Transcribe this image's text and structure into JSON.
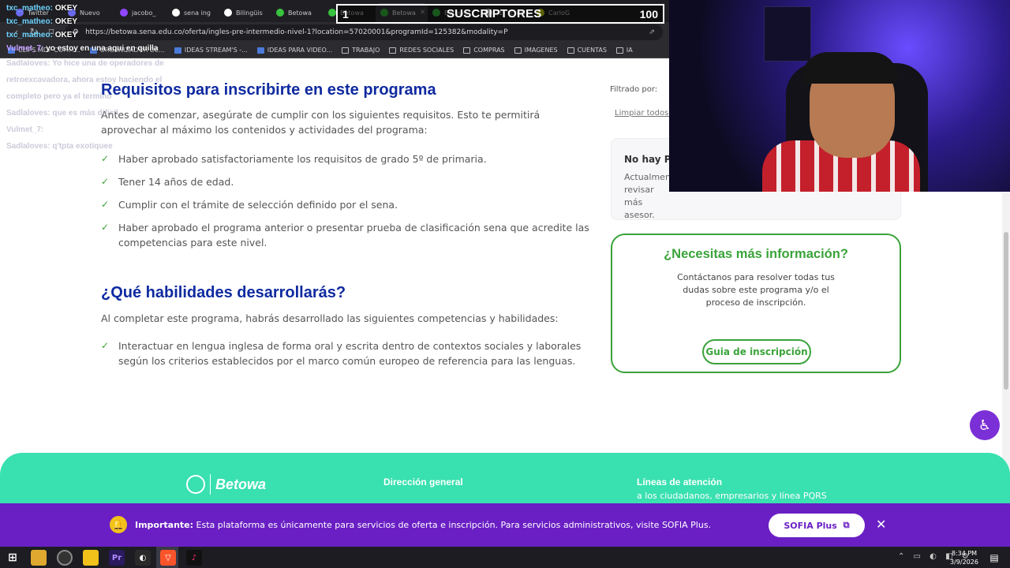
{
  "browser": {
    "tabs": [
      {
        "label": "Twitter",
        "color": "#6a6aee"
      },
      {
        "label": "Nuevo",
        "color": "#6a6aee"
      },
      {
        "label": "jacobo_",
        "color": "#9146ff"
      },
      {
        "label": "sena ing",
        "color": "#ffffff"
      },
      {
        "label": "Bilingüis",
        "color": "#ffffff"
      },
      {
        "label": "Betowa",
        "color": "#39c23f"
      },
      {
        "label": "Betowa",
        "color": "#39c23f"
      },
      {
        "label": "Betowa",
        "color": "#39c23f"
      },
      {
        "label": "Betowa",
        "color": "#39c23f"
      },
      {
        "label": "(1) \"cristi",
        "color": "#dddddd"
      },
      {
        "label": "CarloG",
        "color": "#c8d400"
      }
    ],
    "url": "https://betowa.sena.edu.co/oferta/ingles-pre-intermedio-nivel-1?location=57020001&programId=125382&modality=P",
    "bookmarks": [
      "CLIPS MDP COMM...",
      "ORGANIZADOR DE...",
      "IDEAS STREAM'S -...",
      "IDEAS PARA VIDEO...",
      "TRABAJO",
      "REDES SOCIALES",
      "COMPRAS",
      "IMAGENES",
      "CUENTAS",
      "IA"
    ]
  },
  "stream": {
    "sub_count": "1",
    "sub_label": "SUSCRIPTORES",
    "sub_goal": "100",
    "chat": [
      {
        "user": "txc_matheo:",
        "text": "OKEY"
      },
      {
        "user": "txc_matheo:",
        "text": "OKEY"
      },
      {
        "user": "txc_matheo:",
        "text": "OKEY"
      },
      {
        "user": "Vulmet_7:",
        "text": "yo estoy en una aqui en quilla"
      }
    ],
    "faded_chat": [
      "Sadlaloves: Yo hice una de operadores de retroexcavadora, ahora estoy haciendo el completo pero ya el termino",
      "Sadlaloves: que es más difícil",
      "Vulmet_7:",
      "Sadlaloves: q'tpta exotiquee"
    ]
  },
  "requirements": {
    "title": "Requisitos para inscribirte en este programa",
    "intro": "Antes de comenzar, asegúrate de cumplir con los siguientes requisitos. Esto te permitirá aprovechar al máximo los contenidos y actividades del programa:",
    "items": [
      "Haber aprobado satisfactoriamente los requisitos de grado 5º de primaria.",
      "Tener 14 años de edad.",
      "Cumplir con el trámite de selección definido por el sena.",
      "Haber aprobado el programa anterior o presentar prueba de clasificación sena que acredite las competencias para este nivel."
    ]
  },
  "skills": {
    "title": "¿Qué habilidades desarrollarás?",
    "intro": "Al completar este programa, habrás desarrollado las siguientes competencias y habilidades:",
    "items": [
      "Interactuar en lengua inglesa de forma oral y escrita dentro de contextos sociales y laborales según los criterios establecidos por el marco común europeo de referencia para las lenguas."
    ]
  },
  "sidebar": {
    "filter_label": "Filtrado por:",
    "clear_filters": "Limpiar todos f",
    "no_programs_title": "No hay Pr",
    "no_programs_text": "Actualmen revisar más asesor."
  },
  "info_card": {
    "title": "¿Necesitas más información?",
    "text": "Contáctanos para resolver todas tus dudas sobre este programa y/o el proceso de inscripción.",
    "button": "Guia de inscripción"
  },
  "footer": {
    "brand": "Betowa",
    "col1_title": "Dirección general",
    "col2_title": "Líneas de atención",
    "col2_sub": "a los ciudadanos, empresarios y línea PQRS"
  },
  "notice": {
    "label": "Importante:",
    "text": "Esta plataforma es únicamente para servicios de oferta e inscripción. Para servicios administrativos, visite SOFIA Plus.",
    "button": "SOFIA Plus"
  },
  "taskbar": {
    "time": "8:34 PM",
    "date": "3/9/2026"
  },
  "colors": {
    "heading_blue": "#0f2aa0",
    "accent_green": "#3aa33a",
    "footer_teal": "#39e0b0",
    "notice_purple": "#6a1fc4"
  }
}
